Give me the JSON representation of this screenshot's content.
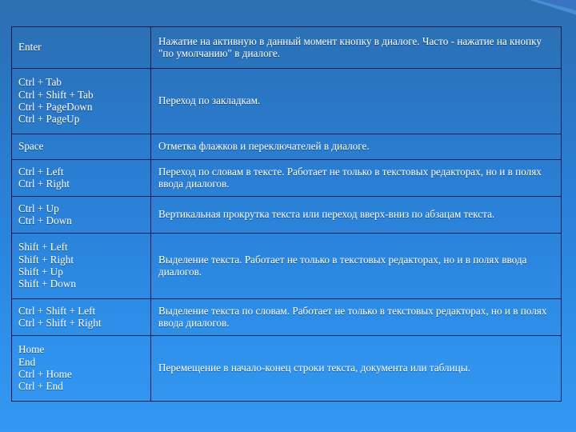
{
  "slide": {
    "title": "",
    "background": {
      "gradient_top": "#2e6fb0",
      "gradient_bottom": "#3497f0",
      "ribbon_dark": "#000072",
      "ribbon_light": "#4f9ae0"
    },
    "text_color": "#ffffff",
    "border_color": "#18184a"
  },
  "table": {
    "name": "keyboard-shortcuts-table",
    "columns": 2,
    "rows": [
      {
        "keys": [
          "Enter"
        ],
        "description": "Нажатие на активную в данный момент кнопку в диалоге. Часто - нажатие на кнопку \"по умолчанию\" в диалоге."
      },
      {
        "keys": [
          "Ctrl + Tab",
          "Ctrl + Shift + Tab",
          "Ctrl + PageDown",
          "Ctrl + PageUp"
        ],
        "description": "Переход по закладкам."
      },
      {
        "keys": [
          "Space"
        ],
        "description": "Отметка флажков и переключателей в диалоге."
      },
      {
        "keys": [
          "Ctrl + Left",
          "Ctrl + Right"
        ],
        "description": "Переход по словам в тексте. Работает не только в текстовых редакторах, но и в полях ввода диалогов."
      },
      {
        "keys": [
          "Ctrl + Up",
          "Ctrl + Down"
        ],
        "description": "Вертикальная прокрутка текста или переход вверх-вниз по абзацам текста."
      },
      {
        "keys": [
          "Shift + Left",
          "Shift + Right",
          "Shift + Up",
          "Shift + Down"
        ],
        "description": "Выделение текста. Работает не только в текстовых редакторах, но и в полях ввода диалогов."
      },
      {
        "keys": [
          "Ctrl + Shift + Left",
          "Ctrl + Shift + Right"
        ],
        "description": "Выделение текста по словам. Работает не только в текстовых редакторах, но и в полях ввода диалогов."
      },
      {
        "keys": [
          "Home",
          "End",
          "Ctrl + Home",
          "Ctrl + End"
        ],
        "description": "Перемещение в начало-конец строки текста, документа или таблицы."
      }
    ]
  }
}
